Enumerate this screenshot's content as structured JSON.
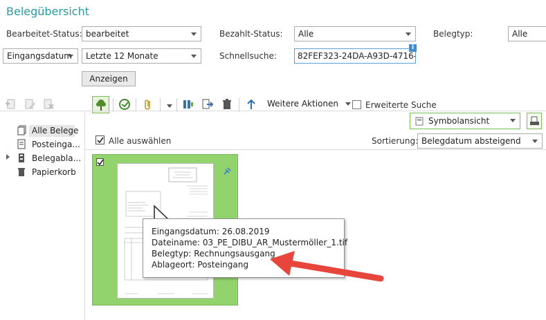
{
  "page_title": "Belegübersicht",
  "filters": {
    "bearbeitet_label": "Bearbeitet-Status:",
    "bearbeitet_value": "bearbeitet",
    "bezahlt_label": "Bezahlt-Status:",
    "bezahlt_value": "Alle",
    "belegtyp_label": "Belegtyp:",
    "belegtyp_value": "Alle",
    "datefield_value": "Eingangsdatum",
    "period_value": "Letzte 12 Monate",
    "quicksearch_label": "Schnellsuche:",
    "quicksearch_value": "82FEF323-24DA-A93D-4716-...",
    "info_badge": "i",
    "show_button": "Anzeigen"
  },
  "toolbar": {
    "more_actions": "Weitere Aktionen",
    "extended_search": "Erweiterte Suche",
    "view_mode": "Symbolansicht"
  },
  "sidebar": {
    "items": [
      {
        "label": "Alle Belege"
      },
      {
        "label": "Posteinga..."
      },
      {
        "label": "Belegabla..."
      },
      {
        "label": "Papierkorb"
      }
    ]
  },
  "list": {
    "select_all": "Alle auswählen",
    "sort_label": "Sortierung:",
    "sort_value": "Belegdatum absteigend"
  },
  "tooltip": {
    "line1": "Eingangsdatum: 26.08.2019",
    "line2": "Dateiname: 03_PE_DIBU_AR_Mustermöller_1.tif",
    "line3": "Belegtyp: Rechnungsausgang",
    "line4": "Ablageort: Posteingang"
  },
  "colors": {
    "accent": "#2b9aa0",
    "selected_green": "#92d36e",
    "arrow_red": "#e8453c",
    "input_focus": "#5aa0d8"
  }
}
